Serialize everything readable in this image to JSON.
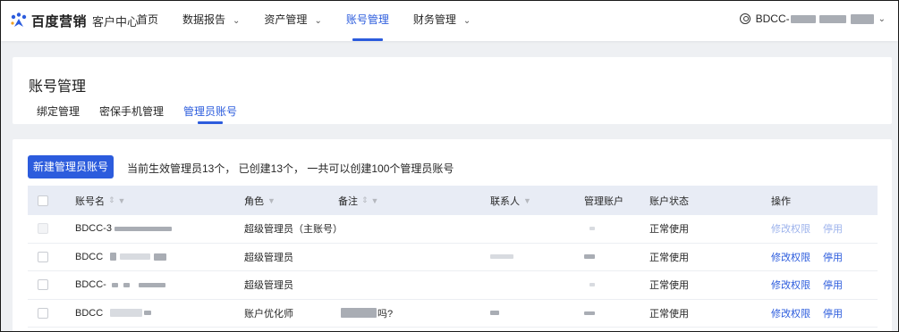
{
  "nav": {
    "brand": "百度营销",
    "brand_sub": "客户中心",
    "items": [
      {
        "label": "首页",
        "has_dropdown": false,
        "active": false
      },
      {
        "label": "数据报告",
        "has_dropdown": true,
        "active": false
      },
      {
        "label": "资产管理",
        "has_dropdown": true,
        "active": false
      },
      {
        "label": "账号管理",
        "has_dropdown": false,
        "active": true
      },
      {
        "label": "财务管理",
        "has_dropdown": true,
        "active": false
      }
    ],
    "user_label": "BDCC-",
    "chevron": "⌄"
  },
  "page": {
    "title": "账号管理",
    "tabs": [
      {
        "label": "绑定管理",
        "active": false
      },
      {
        "label": "密保手机管理",
        "active": false
      },
      {
        "label": "管理员账号",
        "active": true
      }
    ]
  },
  "toolbar": {
    "create_button": "新建管理员账号",
    "summary": "当前生效管理员13个， 已创建13个， 一共可以创建100个管理员账号"
  },
  "table": {
    "headers": {
      "account": "账号名",
      "role": "角色",
      "note": "备注",
      "contact": "联系人",
      "managed": "管理账户",
      "status": "账户状态",
      "actions": "操作"
    },
    "sort_glyph": "⇕",
    "filter_glyph": "▼",
    "rows": [
      {
        "account": "BDCC-3",
        "role": "超级管理员（主账号）",
        "note": "",
        "status": "正常使用",
        "edit": "修改权限",
        "disable": "停用",
        "actions_enabled": false,
        "checkbox_enabled": false
      },
      {
        "account": "BDCC",
        "role": "超级管理员",
        "note": "",
        "status": "正常使用",
        "edit": "修改权限",
        "disable": "停用",
        "actions_enabled": true,
        "checkbox_enabled": true
      },
      {
        "account": "BDCC-",
        "role": "超级管理员",
        "note": "",
        "status": "正常使用",
        "edit": "修改权限",
        "disable": "停用",
        "actions_enabled": true,
        "checkbox_enabled": true
      },
      {
        "account": "BDCC",
        "role": "账户优化师",
        "note": "吗?",
        "status": "正常使用",
        "edit": "修改权限",
        "disable": "停用",
        "actions_enabled": true,
        "checkbox_enabled": true
      }
    ]
  },
  "colors": {
    "accent": "#2c5cdd",
    "header_bg": "#e8ecf5",
    "page_bg": "#eef0f3"
  }
}
